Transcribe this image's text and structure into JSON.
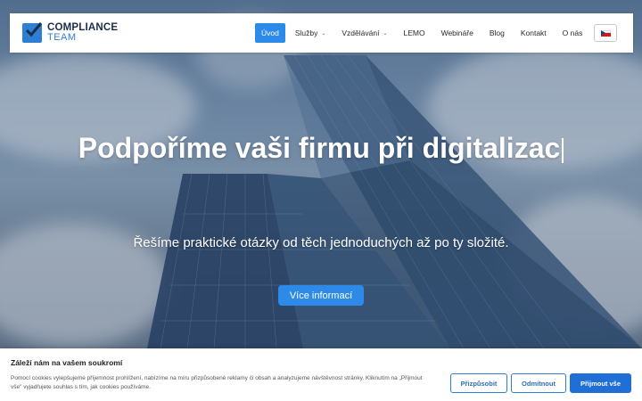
{
  "header": {
    "logo_line1": "COMPLIANCE",
    "logo_line2": "TEAM",
    "nav": [
      {
        "label": "Úvod"
      },
      {
        "label": "Služby"
      },
      {
        "label": "Vzdělávání"
      },
      {
        "label": "LEMO"
      },
      {
        "label": "Webináře"
      },
      {
        "label": "Blog"
      },
      {
        "label": "Kontakt"
      },
      {
        "label": "O nás"
      }
    ],
    "dropdown_caret": "⌄",
    "language_flag": "czech-flag-icon"
  },
  "hero": {
    "headline": "Podpoříme vaši firmu při digitalizac",
    "subline": "Řešíme praktické otázky od těch jednoduchých až po ty složité.",
    "cta_label": "Více informací"
  },
  "cookie_banner": {
    "title": "Záleží nám na vašem soukromí",
    "text": "Pomocí cookies vylepšujeme příjemnost prohlížení, nabízíme na míru přizpůsobené reklamy či obsah a analyzujeme návštěvnost stránky. Kliknutím na „Přijmout vše\" vyjadřujete souhlas s tím, jak cookies používáme.",
    "btn_customize": "Přizpůsobit",
    "btn_reject": "Odmítnout",
    "btn_accept": "Přijmout vše"
  },
  "colors": {
    "accent": "#2d8ae8",
    "brand_dark": "#1c2d4a",
    "accept_button": "#1f6fd6"
  }
}
